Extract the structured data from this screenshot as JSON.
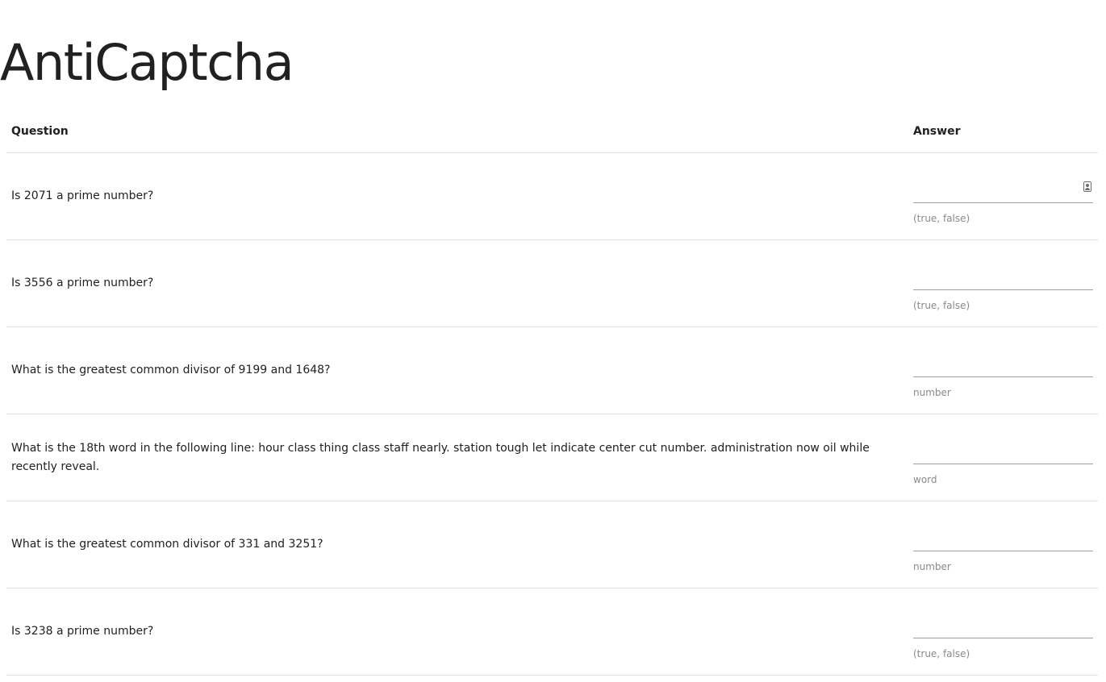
{
  "page": {
    "title": "AntiCaptcha"
  },
  "table": {
    "headers": {
      "question": "Question",
      "answer": "Answer"
    },
    "rows": [
      {
        "question": "Is 2071 a prime number?",
        "answer_value": "",
        "hint": "(true, false)",
        "icon": "contact-card-icon"
      },
      {
        "question": "Is 3556 a prime number?",
        "answer_value": "",
        "hint": "(true, false)"
      },
      {
        "question": "What is the greatest common divisor of 9199 and 1648?",
        "answer_value": "",
        "hint": "number"
      },
      {
        "question": "What is the 18th word in the following line: hour class thing class staff nearly. station tough let indicate center cut number. administration now oil while recently reveal.",
        "answer_value": "",
        "hint": "word"
      },
      {
        "question": "What is the greatest common divisor of 331 and 3251?",
        "answer_value": "",
        "hint": "number"
      },
      {
        "question": "Is 3238 a prime number?",
        "answer_value": "",
        "hint": "(true, false)"
      }
    ]
  }
}
